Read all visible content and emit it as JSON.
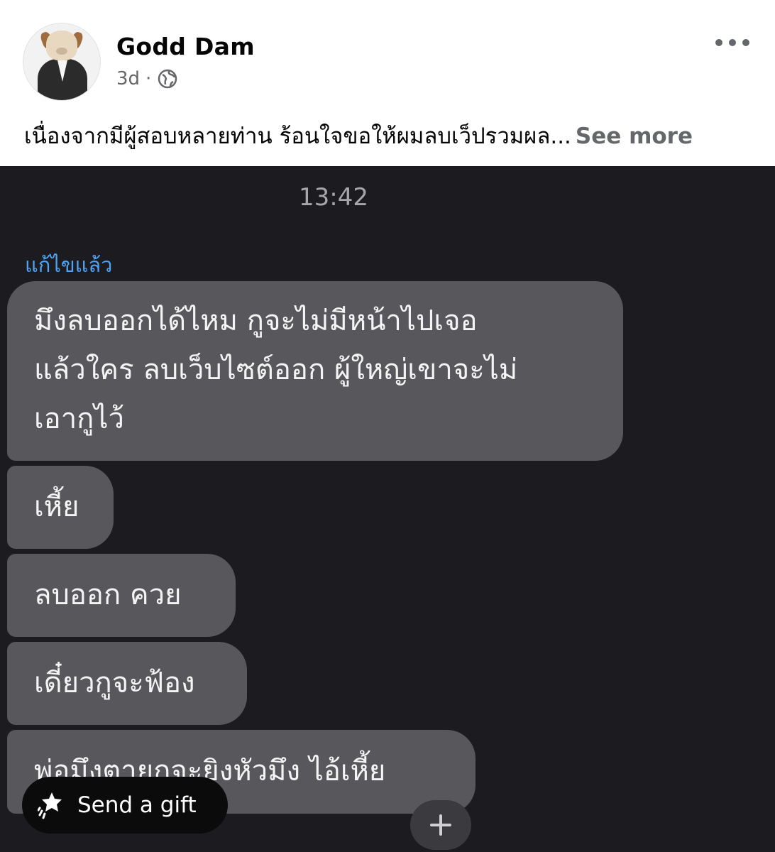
{
  "post": {
    "author": "Godd Dam",
    "time": "3d",
    "separator": "·",
    "privacy_icon": "globe-icon",
    "more_icon": "more-horizontal-icon",
    "text": "เนื่องจากมีผู้สอบหลายท่าน ร้อนใจขอให้ผมลบเว็ปรวมผล...",
    "see_more_label": "See more"
  },
  "screenshot": {
    "time": "13:42",
    "edited_label": "แก้ไขแล้ว",
    "messages": [
      {
        "lines": [
          "มึงลบออกได้ไหม กูจะไม่มีหน้าไปเจอ",
          "แล้วใคร ลบเว็บไซต์ออก ผู้ใหญ่เขาจะไม่",
          "เอากูไว้"
        ]
      },
      {
        "lines": [
          "เหี้ย"
        ]
      },
      {
        "lines": [
          "ลบออก ควย"
        ]
      },
      {
        "lines": [
          "เดี๋ยวกูจะฟ้อง"
        ]
      },
      {
        "lines": [
          "พ่อมึงตายกูจะยิงหัวมึง ไอ้เหี้ย"
        ]
      }
    ]
  },
  "overlay": {
    "gift_label": "Send a gift",
    "gift_icon": "gift-star-icon",
    "plus_icon": "plus-icon"
  }
}
